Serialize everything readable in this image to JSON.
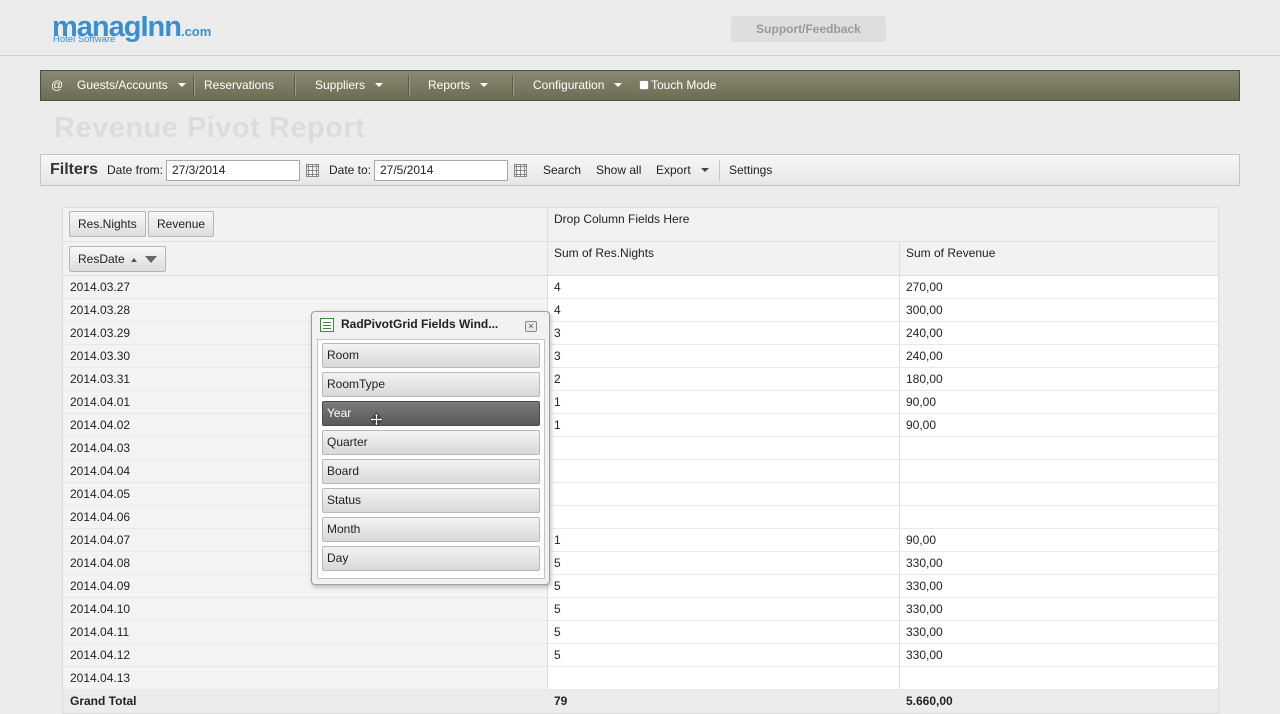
{
  "header": {
    "logo_main": "managInn",
    "logo_dotcom": ".com",
    "logo_sub": "Hotel Software",
    "support_label": "Support/Feedback"
  },
  "nav": {
    "at": "@",
    "items": [
      "Guests/Accounts",
      "Reservations",
      "Suppliers",
      "Reports",
      "Configuration"
    ],
    "touch_mode": "Touch Mode"
  },
  "page": {
    "title": "Revenue Pivot Report"
  },
  "filters": {
    "title": "Filters",
    "date_from_label": "Date from:",
    "date_from_value": "27/3/2014",
    "date_to_label": "Date to:",
    "date_to_value": "27/5/2014",
    "search": "Search",
    "show_all": "Show all",
    "export": "Export",
    "settings": "Settings"
  },
  "pivot": {
    "data_fields": [
      "Res.Nights",
      "Revenue"
    ],
    "row_field": "ResDate",
    "column_drop_zone": "Drop Column Fields Here",
    "column_headers": [
      "Sum of Res.Nights",
      "Sum of Revenue"
    ],
    "rows": [
      {
        "date": "2014.03.27",
        "nights": "4",
        "revenue": "270,00"
      },
      {
        "date": "2014.03.28",
        "nights": "4",
        "revenue": "300,00"
      },
      {
        "date": "2014.03.29",
        "nights": "3",
        "revenue": "240,00"
      },
      {
        "date": "2014.03.30",
        "nights": "3",
        "revenue": "240,00"
      },
      {
        "date": "2014.03.31",
        "nights": "2",
        "revenue": "180,00"
      },
      {
        "date": "2014.04.01",
        "nights": "1",
        "revenue": "90,00"
      },
      {
        "date": "2014.04.02",
        "nights": "1",
        "revenue": "90,00"
      },
      {
        "date": "2014.04.03",
        "nights": "",
        "revenue": ""
      },
      {
        "date": "2014.04.04",
        "nights": "",
        "revenue": ""
      },
      {
        "date": "2014.04.05",
        "nights": "",
        "revenue": ""
      },
      {
        "date": "2014.04.06",
        "nights": "",
        "revenue": ""
      },
      {
        "date": "2014.04.07",
        "nights": "1",
        "revenue": "90,00"
      },
      {
        "date": "2014.04.08",
        "nights": "5",
        "revenue": "330,00"
      },
      {
        "date": "2014.04.09",
        "nights": "5",
        "revenue": "330,00"
      },
      {
        "date": "2014.04.10",
        "nights": "5",
        "revenue": "330,00"
      },
      {
        "date": "2014.04.11",
        "nights": "5",
        "revenue": "330,00"
      },
      {
        "date": "2014.04.12",
        "nights": "5",
        "revenue": "330,00"
      },
      {
        "date": "2014.04.13",
        "nights": "",
        "revenue": ""
      }
    ],
    "grand_total": {
      "label": "Grand Total",
      "nights": "79",
      "revenue": "5.660,00"
    }
  },
  "fields_window": {
    "title": "RadPivotGrid Fields Wind...",
    "close": "×",
    "fields": [
      "Room",
      "RoomType",
      "Year",
      "Quarter",
      "Board",
      "Status",
      "Month",
      "Day"
    ],
    "active_field": "Year"
  },
  "icons": {
    "calendar": "calendar-icon",
    "filter": "filter-icon",
    "move": "move-cursor-icon"
  },
  "colors": {
    "navbar": "#7a7a63",
    "logo_blue": "#3a8fd0",
    "active_field": "#666666"
  }
}
